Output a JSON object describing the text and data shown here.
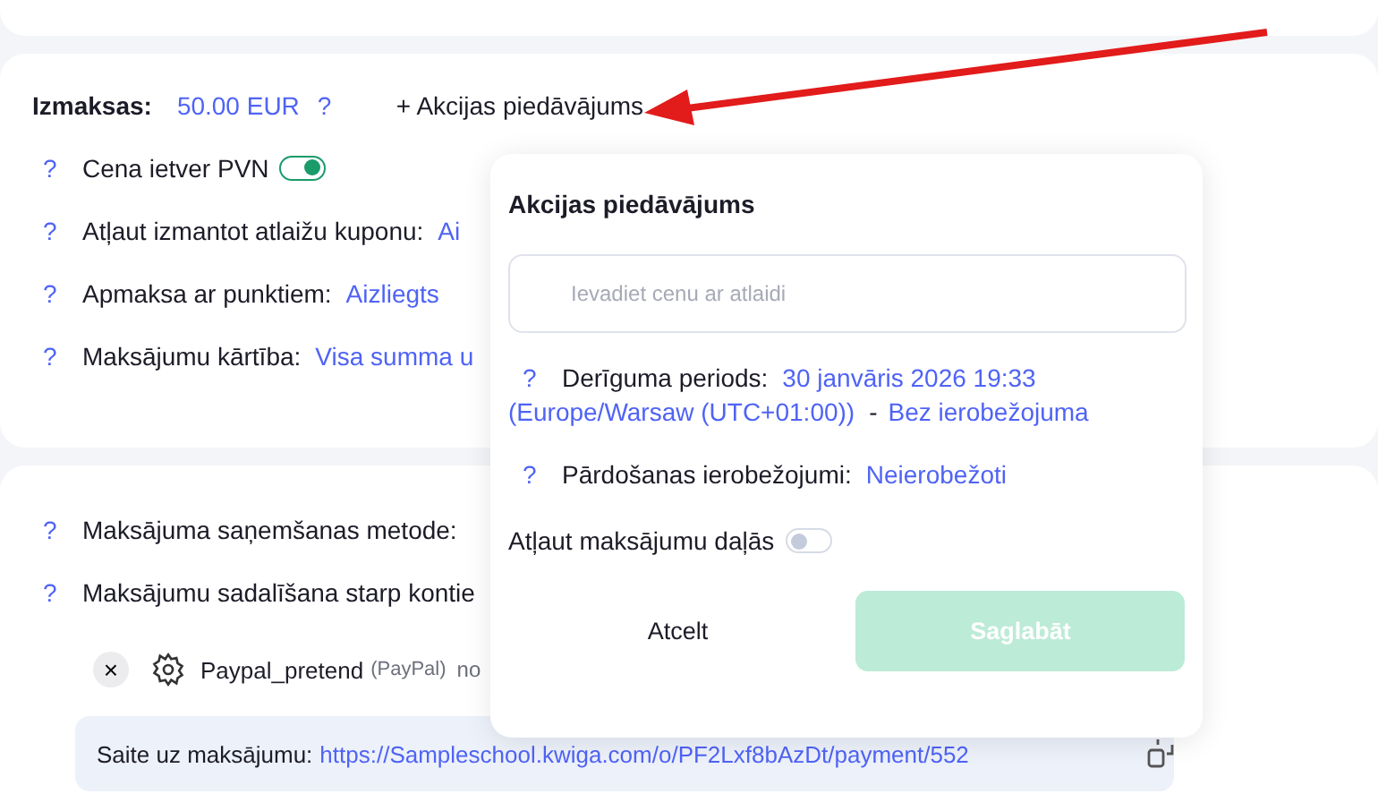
{
  "price_section": {
    "label": "Izmaksas:",
    "price": "50.00 EUR",
    "help": "?",
    "promo_link": "+ Akcijas piedāvājums",
    "rows": [
      {
        "kind": "toggle",
        "help": "?",
        "label": "Cena ietver PVN",
        "on": true
      },
      {
        "kind": "value",
        "help": "?",
        "label": "Atļaut izmantot atlaižu kuponu:",
        "value": "Ai"
      },
      {
        "kind": "value",
        "help": "?",
        "label": "Apmaksa ar punktiem:",
        "value": "Aizliegts"
      },
      {
        "kind": "value",
        "help": "?",
        "label": "Maksājumu kārtība:",
        "value": "Visa summa u"
      }
    ]
  },
  "payment_section": {
    "rows": [
      {
        "help": "?",
        "label": "Maksājuma saņemšanas metode:"
      },
      {
        "help": "?",
        "label": "Maksājumu sadalīšana starp kontie"
      }
    ],
    "method": {
      "remove": "×",
      "name": "Paypal_pretend",
      "provider": "(PayPal)",
      "status": "no"
    },
    "link": {
      "label": "Saite uz maksājumu:",
      "url": "https://Sampleschool.kwiga.com/o/PF2Lxf8bAzDt/payment/552"
    }
  },
  "popup": {
    "title": "Akcijas piedāvājums",
    "placeholder": "Ievadiet cenu ar atlaidi",
    "validity": {
      "help": "?",
      "label": "Derīguma periods:",
      "start": "30 janvāris 2026 19:33",
      "timezone": "(Europe/Warsaw (UTC+01:00))",
      "separator": "-",
      "end": "Bez ierobežojuma"
    },
    "limits": {
      "help": "?",
      "label": "Pārdošanas ierobežojumi:",
      "value": "Neierobežoti"
    },
    "installments": {
      "label": "Atļaut maksājumu daļās",
      "on": false
    },
    "cancel": "Atcelt",
    "save": {
      "label": "Saglabāt",
      "disabled": true
    }
  }
}
